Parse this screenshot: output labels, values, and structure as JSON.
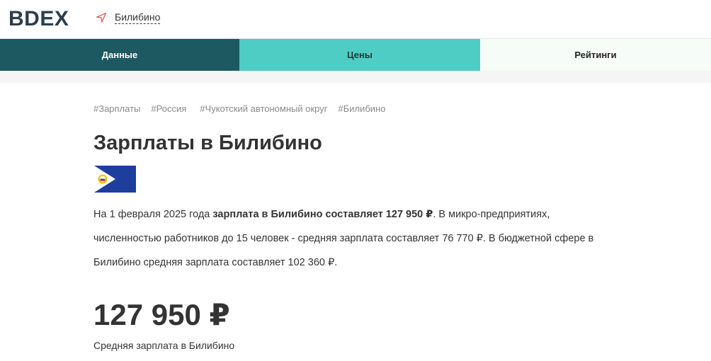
{
  "header": {
    "logo": "BDEX",
    "location": "Билибино"
  },
  "tabs": [
    {
      "label": "Данные"
    },
    {
      "label": "Цены"
    },
    {
      "label": "Рейтинги"
    }
  ],
  "tags": [
    "#Зарплаты",
    "#Россия",
    "#Чукотский автономный округ",
    "#Билибино"
  ],
  "page_title": "Зарплаты в Билибино",
  "description": {
    "part1": "На 1 февраля 2025 года ",
    "bold": "зарплата в Билибино составляет 127 950 ₽",
    "part2": ". В микро-предприятиях, численностью работников до 15 человек - средняя зарплата составляет 76 770 ₽. В бюджетной сфере в Билибино средняя зарплата составляет 102 360 ₽."
  },
  "summary": {
    "value": "127 950 ₽",
    "label": "Средняя зарплата в Билибино"
  },
  "colors": {
    "tab_active": "#1c5960",
    "tab_teal": "#4ecdc4",
    "flag_blue": "#1d3e9c",
    "logo": "#2c3e50"
  }
}
